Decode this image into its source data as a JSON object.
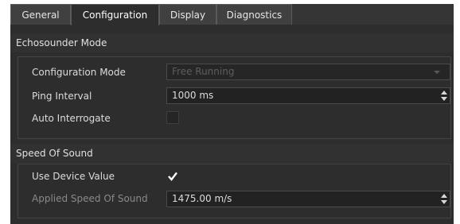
{
  "tabs": [
    {
      "label": "General"
    },
    {
      "label": "Configuration",
      "active": true
    },
    {
      "label": "Display"
    },
    {
      "label": "Diagnostics"
    }
  ],
  "echosounder": {
    "title": "Echosounder Mode",
    "configuration_mode": {
      "label": "Configuration Mode",
      "value": "Free Running",
      "enabled": false
    },
    "ping_interval": {
      "label": "Ping Interval",
      "value": "1000 ms"
    },
    "auto_interrogate": {
      "label": "Auto Interrogate",
      "checked": false,
      "enabled": false
    }
  },
  "speed_of_sound": {
    "title": "Speed Of Sound",
    "use_device_value": {
      "label": "Use Device Value",
      "checked": true
    },
    "applied_speed": {
      "label": "Applied Speed Of Sound",
      "value": "1475.00 m/s",
      "enabled": false
    }
  },
  "icons": {
    "spin": "up-down-arrows-icon",
    "dropdown": "chevron-down-icon",
    "check": "checkmark-icon"
  }
}
